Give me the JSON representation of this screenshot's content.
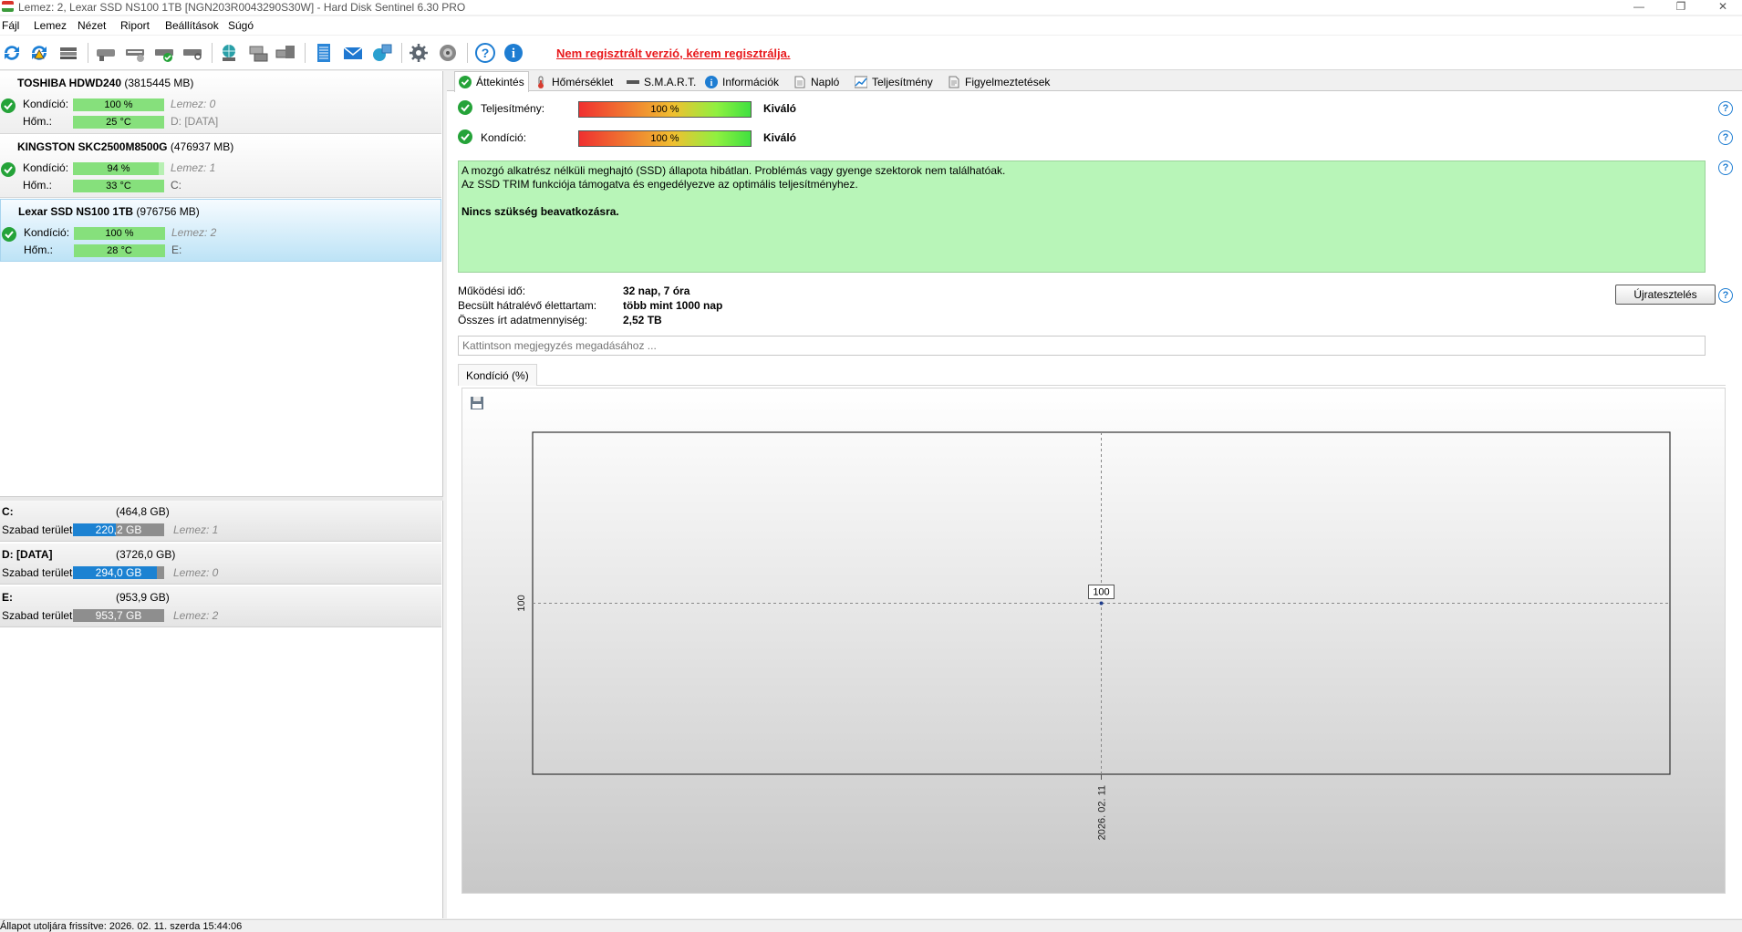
{
  "window": {
    "title": "Lemez: 2, Lexar SSD NS100 1TB [NGN203R0043290S30W]  -  Hard Disk Sentinel 6.30 PRO",
    "minimize": "—",
    "restore": "❐",
    "close": "✕"
  },
  "menu": [
    "Fájl",
    "Lemez",
    "Nézet",
    "Riport",
    "Beállítások",
    "Súgó"
  ],
  "toolbar": {
    "unregistered": "Nem regisztrált verzió, kérem regisztrálja."
  },
  "disks": [
    {
      "name": "TOSHIBA HDWD240",
      "size": "(3815445 MB)",
      "condition_label": "Kondíció:",
      "condition": "100 %",
      "condition_pct": 100,
      "temp_label": "Hőm.:",
      "temp": "25 °C",
      "disk_ref": "Lemez: 0",
      "volume": "D: [DATA]"
    },
    {
      "name": "KINGSTON SKC2500M8500G",
      "size": "(476937 MB)",
      "condition_label": "Kondíció:",
      "condition": "94 %",
      "condition_pct": 94,
      "temp_label": "Hőm.:",
      "temp": "33 °C",
      "disk_ref": "Lemez: 1",
      "volume": "C:"
    },
    {
      "name": "Lexar SSD NS100 1TB",
      "size": "(976756 MB)",
      "condition_label": "Kondíció:",
      "condition": "100 %",
      "condition_pct": 100,
      "temp_label": "Hőm.:",
      "temp": "28 °C",
      "disk_ref": "Lemez: 2",
      "volume": "E:"
    }
  ],
  "volumes": [
    {
      "name": "C:",
      "size": "(464,8 GB)",
      "free_label": "Szabad terület",
      "free": "220,2 GB",
      "used_fraction": 0.47,
      "disk_ref": "Lemez: 1"
    },
    {
      "name": "D: [DATA]",
      "size": "(3726,0 GB)",
      "free_label": "Szabad terület",
      "free": "294,0 GB",
      "used_fraction": 0.92,
      "disk_ref": "Lemez: 0"
    },
    {
      "name": "E:",
      "size": "(953,9 GB)",
      "free_label": "Szabad terület",
      "free": "953,7 GB",
      "used_fraction": 0.0,
      "disk_ref": "Lemez: 2"
    }
  ],
  "tabs": [
    "Áttekintés",
    "Hőmérséklet",
    "S.M.A.R.T.",
    "Információk",
    "Napló",
    "Teljesítmény",
    "Figyelmeztetések"
  ],
  "overview": {
    "performance_label": "Teljesítmény:",
    "performance_value": "100 %",
    "performance_rating": "Kiváló",
    "condition_label": "Kondíció:",
    "condition_value": "100 %",
    "condition_rating": "Kiváló",
    "status_line1": "A mozgó alkatrész nélküli meghajtó (SSD) állapota hibátlan. Problémás vagy gyenge szektorok nem találhatóak.",
    "status_line2": "Az SSD TRIM funkciója támogatva és engedélyezve az optimális teljesítményhez.",
    "status_line3": "Nincs szükség beavatkozásra.",
    "uptime_label": "Működési idő:",
    "uptime_value": "32 nap, 7 óra",
    "lifetime_label": "Becsült hátralévő élettartam:",
    "lifetime_value": "több mint 1000 nap",
    "written_label": "Összes írt adatmennyiség:",
    "written_value": "2,52 TB",
    "retest_button": "Újratesztelés",
    "note_placeholder": "Kattintson megjegyzés megadásához ...",
    "help": "?"
  },
  "chart_tab_label": "Kondíció  (%)",
  "chart_data": {
    "type": "line",
    "x": [
      "2026. 02. 11"
    ],
    "series": [
      {
        "values": [
          100
        ]
      }
    ],
    "y_tick_labels": [
      "100"
    ],
    "x_tick_labels": [
      "2026. 02. 11"
    ],
    "data_labels": [
      "100"
    ],
    "grid": true
  },
  "statusbar": {
    "text": "Állapot utoljára frissítve: 2026. 02. 11. szerda 15:44:06"
  }
}
